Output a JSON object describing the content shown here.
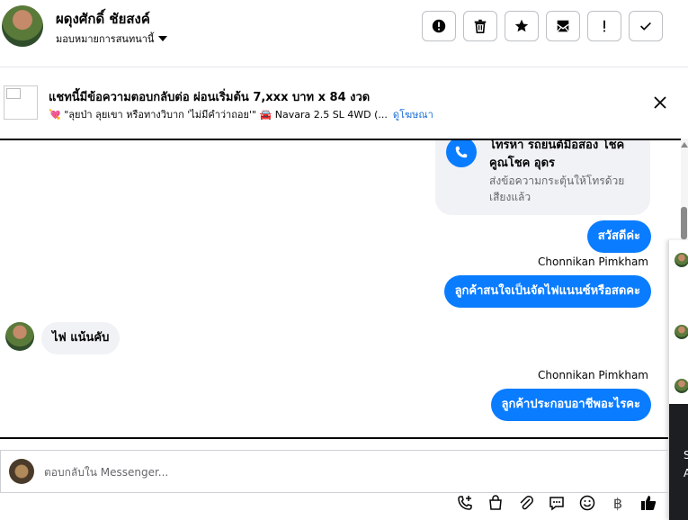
{
  "header": {
    "contact_name": "ผดุงศักดิ์ ชัยสงค์",
    "assign_label": "มอบหมายการสนทนานี้",
    "actions": [
      {
        "icon": "alert-circle-icon",
        "name": "mark-spam-button"
      },
      {
        "icon": "trash-icon",
        "name": "delete-button"
      },
      {
        "icon": "star-icon",
        "name": "star-button"
      },
      {
        "icon": "mail-unread-icon",
        "name": "mark-unread-button"
      },
      {
        "icon": "exclamation-icon",
        "name": "follow-up-button"
      },
      {
        "icon": "check-icon",
        "name": "mark-done-button"
      }
    ]
  },
  "ad": {
    "title": "แชทนี้มีข้อความตอบกลับต่อ ผ่อนเริ่มต้น 7,xxx บาท x 84 งวด",
    "description": "💘 \"ลุยป่า ลุยเขา หรือทางวิบาก 'ไม่มีคำว่าถอย'\" 🚘 Navara 2.5 SL 4WD (...",
    "link": "ดูโฆษณา"
  },
  "thread": {
    "call_card": {
      "title": "โทรหา รถยนต์มือสอง โชคคูณโชค อุดร",
      "subtitle": "ส่งข้อความกระตุ้นให้โทรด้วยเสียงแล้ว"
    },
    "messages": [
      {
        "side": "out",
        "sender": "",
        "text": "สวัสดีค่ะ"
      },
      {
        "side": "out",
        "sender": "Chonnikan Pimkham",
        "text": "ลูกค้าสนใจเป็นจัดไฟแนนซ์หรือสดคะ"
      },
      {
        "side": "in",
        "sender": "",
        "text": "ไฟ แน้นคับ"
      },
      {
        "side": "out",
        "sender": "Chonnikan Pimkham",
        "text": "ลูกค้าประกอบอาชีพอะไรคะ"
      }
    ]
  },
  "side_panel": {
    "dark_text_1": "S",
    "dark_text_2": "A"
  },
  "composer": {
    "placeholder": "ตอบกลับใน Messenger...",
    "tools": [
      "phone-add-icon",
      "shopping-bag-icon",
      "paperclip-icon",
      "chat-bubble-icon",
      "emoji-icon",
      "baht-icon",
      "thumbs-up-icon"
    ],
    "baht_symbol": "฿"
  },
  "colors": {
    "accent": "#0a7cff",
    "bubble_in": "#f0f2f5",
    "link": "#1a6ed8"
  }
}
